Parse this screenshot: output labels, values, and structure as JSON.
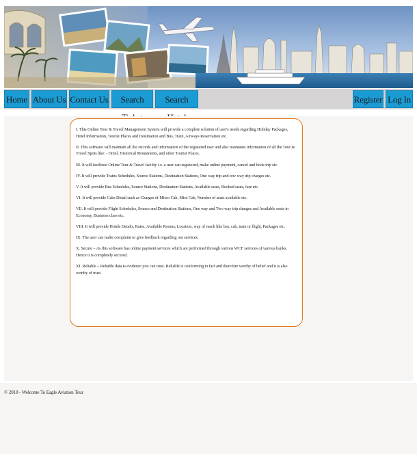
{
  "banner": {
    "scene": "travel collage with airplane, landmarks, hotels and cruise ship"
  },
  "nav": {
    "left": [
      {
        "label": "Home"
      },
      {
        "label": "About Us"
      },
      {
        "label": "Contact Us"
      },
      {
        "label": "Search Ticket"
      },
      {
        "label": "Search Hotel"
      }
    ],
    "right": [
      {
        "label": "Register"
      },
      {
        "label": "Log In"
      }
    ]
  },
  "about": {
    "items": [
      "I. This Online Tour & Travel Management System will provide a complete solution of user's needs regarding Holiday Packages, Hotel Information, Tourist Places and Destination and Bus, Train, Airways Reservation etc.",
      "II. This software will maintain all the records and information of the registered user and also maintains information of all the Tour & Travel Spots like: - Hotel, Historical Monuments, and other Tourist Places.",
      "III. It will facilitate Online Tour & Travel facility i.e. a user can registered, make online payment, cancel and book trip etc.",
      "IV. It will provide Trains Schedules, Source Stations, Destination Stations, One way trip and tow way trip charges etc.",
      "V. It will provide Bus Schedules, Source Stations, Destination Stations, Available seats, Booked seats, fare etc.",
      "VI. It will provide Cabs Detail such as Charges of Micro Cab, Mini Cab, Number of seats available etc.",
      "VII. It will provide Flight Schedules, Source and Destination Stations, One way and Two way trip charges and Available seats in Economy, Business class etc.",
      "VIII. It will provide Hotels Details, Rates, Available Rooms, Location, way of reach like bus, cab, train or flight, Packages etc.",
      "IX. The user can make complaint or give feedback regarding our services.",
      "X. Secure – As this software has online payment services which are performed through various WCF services of various banks. Hence it is completely secured.",
      "XI. Reliable – Reliable data is evidence you can trust. Reliable is conforming to fact and therefore worthy of belief and it is also worthy of trust."
    ]
  },
  "footer": {
    "text": "© 2018 - Welcome To Eagle Aviation Tour"
  },
  "colors": {
    "nav_button": "#1b9bd3",
    "nav_bar": "#d6d4d4",
    "panel_border": "#e07a1c",
    "content_bg": "#f7f4f4"
  }
}
